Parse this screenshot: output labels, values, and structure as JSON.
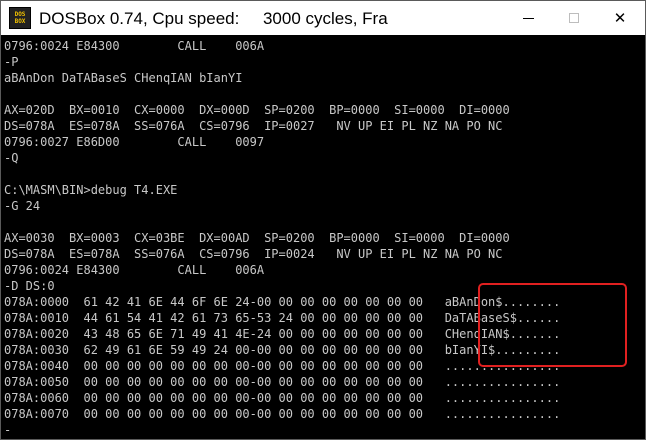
{
  "window": {
    "title": "DOSBox 0.74, Cpu speed:     3000 cycles, Fra",
    "icon_text_top": "DOS",
    "icon_text_bottom": "BOX",
    "controls": {
      "minimize_icon": "minimize-icon",
      "maximize_icon": "maximize-icon",
      "close_icon": "close-icon",
      "close_glyph": "✕"
    }
  },
  "console": {
    "lines": [
      "0796:0024 E84300        CALL    006A",
      "-P",
      "aBAnDon DaTABaseS CHenqIAN bIanYI",
      "",
      "AX=020D  BX=0010  CX=0000  DX=000D  SP=0200  BP=0000  SI=0000  DI=0000",
      "DS=078A  ES=078A  SS=076A  CS=0796  IP=0027   NV UP EI PL NZ NA PO NC",
      "0796:0027 E86D00        CALL    0097",
      "-Q",
      "",
      "C:\\MASM\\BIN>debug T4.EXE",
      "-G 24",
      "",
      "AX=0030  BX=0003  CX=03BE  DX=00AD  SP=0200  BP=0000  SI=0000  DI=0000",
      "DS=078A  ES=078A  SS=076A  CS=0796  IP=0024   NV UP EI PL NZ NA PO NC",
      "0796:0024 E84300        CALL    006A",
      "-D DS:0",
      "078A:0000  61 42 41 6E 44 6F 6E 24-00 00 00 00 00 00 00 00   aBAnDon$........",
      "078A:0010  44 61 54 41 42 61 73 65-53 24 00 00 00 00 00 00   DaTABaseS$......",
      "078A:0020  43 48 65 6E 71 49 41 4E-24 00 00 00 00 00 00 00   CHenqIAN$.......",
      "078A:0030  62 49 61 6E 59 49 24 00-00 00 00 00 00 00 00 00   bIanYI$.........",
      "078A:0040  00 00 00 00 00 00 00 00-00 00 00 00 00 00 00 00   ................",
      "078A:0050  00 00 00 00 00 00 00 00-00 00 00 00 00 00 00 00   ................",
      "078A:0060  00 00 00 00 00 00 00 00-00 00 00 00 00 00 00 00   ................",
      "078A:0070  00 00 00 00 00 00 00 00-00 00 00 00 00 00 00 00   ................",
      "-"
    ]
  },
  "colors": {
    "console_background": "#000000",
    "console_text": "#c8c8c8",
    "highlight_border": "#e02020"
  }
}
